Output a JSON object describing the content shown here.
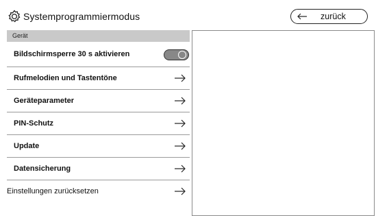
{
  "header": {
    "title": "Systemprogrammiermodus",
    "back_label": "zurück",
    "icon": "gear-icon",
    "back_icon": "arrow-left-icon"
  },
  "section": {
    "label": "Gerät"
  },
  "menu": {
    "items": [
      {
        "label": "Bildschirmsperre 30 s aktivieren",
        "type": "toggle",
        "toggle_on": true
      },
      {
        "label": "Rufmelodien und Tastentöne",
        "type": "link"
      },
      {
        "label": "Geräteparameter",
        "type": "link"
      },
      {
        "label": "PIN-Schutz",
        "type": "link"
      },
      {
        "label": "Update",
        "type": "link"
      },
      {
        "label": "Datensicherung",
        "type": "link"
      },
      {
        "label": "Einstellungen zurücksetzen",
        "type": "link"
      }
    ]
  },
  "colors": {
    "section_bg": "#c9c9c9",
    "toggle_bg": "#888888"
  }
}
